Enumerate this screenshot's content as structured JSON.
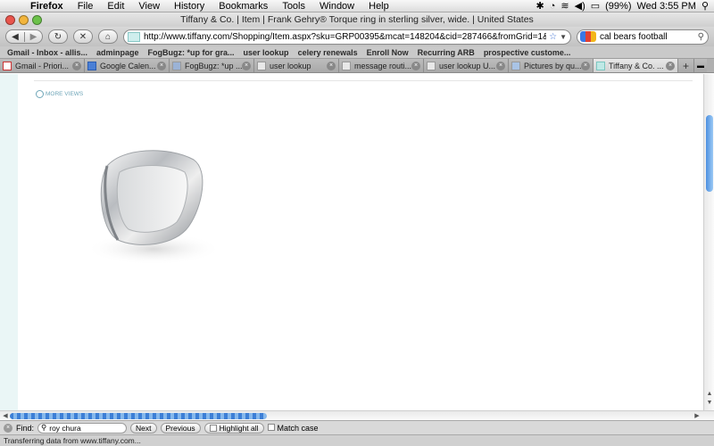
{
  "menubar": {
    "app": "Firefox",
    "items": [
      "File",
      "Edit",
      "View",
      "History",
      "Bookmarks",
      "Tools",
      "Window",
      "Help"
    ],
    "battery": "(99%)",
    "clock": "Wed 3:55 PM"
  },
  "window": {
    "title": "Tiffany & Co. | Item | Frank Gehry® Torque ring in sterling silver, wide. | United States"
  },
  "navbar": {
    "url": "http://www.tiffany.com/Shopping/Item.aspx?sku=GRP00395&mcat=148204&cid=287466&fromGrid=1&search_params=s",
    "search_value": "cal bears football"
  },
  "bookmarks": [
    "Gmail - Inbox - allis...",
    "adminpage",
    "FogBugz: *up for gra...",
    "user lookup",
    "celery renewals",
    "Enroll Now",
    "Recurring ARB",
    "prospective custome..."
  ],
  "tabs": [
    {
      "label": "Gmail - Priori..."
    },
    {
      "label": "Google Calen..."
    },
    {
      "label": "FogBugz: *up ..."
    },
    {
      "label": "user lookup"
    },
    {
      "label": "message routi..."
    },
    {
      "label": "user lookup U..."
    },
    {
      "label": "Pictures by qu..."
    },
    {
      "label": "Tiffany & Co. ..."
    }
  ],
  "content": {
    "more_views": "MORE VIEWS"
  },
  "findbar": {
    "label": "Find:",
    "value": "roy chura",
    "next": "Next",
    "previous": "Previous",
    "highlight": "Highlight all",
    "match_case": "Match case"
  },
  "status": {
    "text": "Transferring data from www.tiffany.com..."
  }
}
